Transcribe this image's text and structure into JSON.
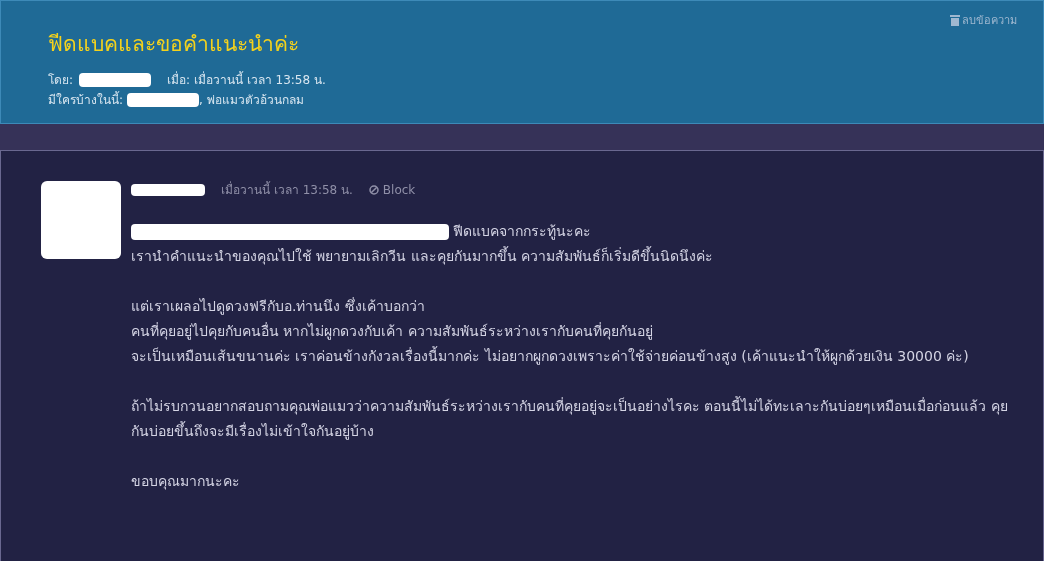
{
  "topic": {
    "title": "ฟีดแบคและขอคำแนะนำค่ะ",
    "delete_label": "ลบข้อความ",
    "by_label": "โดย:",
    "when_label": "เมื่อ:",
    "when": "เมื่อวานนี้ เวลา 13:58 น.",
    "viewers_label": "มีใครบ้างในนี้:",
    "viewers": ", พ่อแมวตัวอ้วนกลม"
  },
  "post": {
    "time": "เมื่อวานนี้ เวลา 13:58 น.",
    "block_label": "Block",
    "first_line": "ฟีดแบคจากกระทู้นะคะ",
    "paragraphs": [
      "เรานำคำแนะนำของคุณไปใช้ พยายามเลิกวีน และคุยกันมากขึ้น ความสัมพันธ์ก็เริ่มดีขึ้นนิดนึงค่ะ",
      "แต่เราเผลอไปดูดวงฟรีกับอ.ท่านนึง ซึ่งเค้าบอกว่า\nคนที่คุยอยู่ไปคุยกับคนอื่น หากไม่ผูกดวงกับเค้า ความสัมพันธ์ระหว่างเรากับคนที่คุยกันอยู่\nจะเป็นเหมือนเส้นขนานค่ะ เราค่อนข้างกังวลเรื่องนี้มากค่ะ ไม่อยากผูกดวงเพราะค่าใช้จ่ายค่อนข้างสูง (เค้าแนะนำให้ผูกด้วยเงิน 30000 ค่ะ)",
      "ถ้าไม่รบกวนอยากสอบถามคุณพ่อแมวว่าความสัมพันธ์ระหว่างเรากับคนที่คุยอยู่จะเป็นอย่างไรคะ ตอนนี้ไม่ได้ทะเลาะกันบ่อยๆเหมือนเมื่อก่อนแล้ว คุยกันบ่อยขึ้นถึงจะมีเรื่องไม่เข้าใจกันอยู่บ้าง",
      "ขอบคุณมากนะคะ"
    ]
  }
}
